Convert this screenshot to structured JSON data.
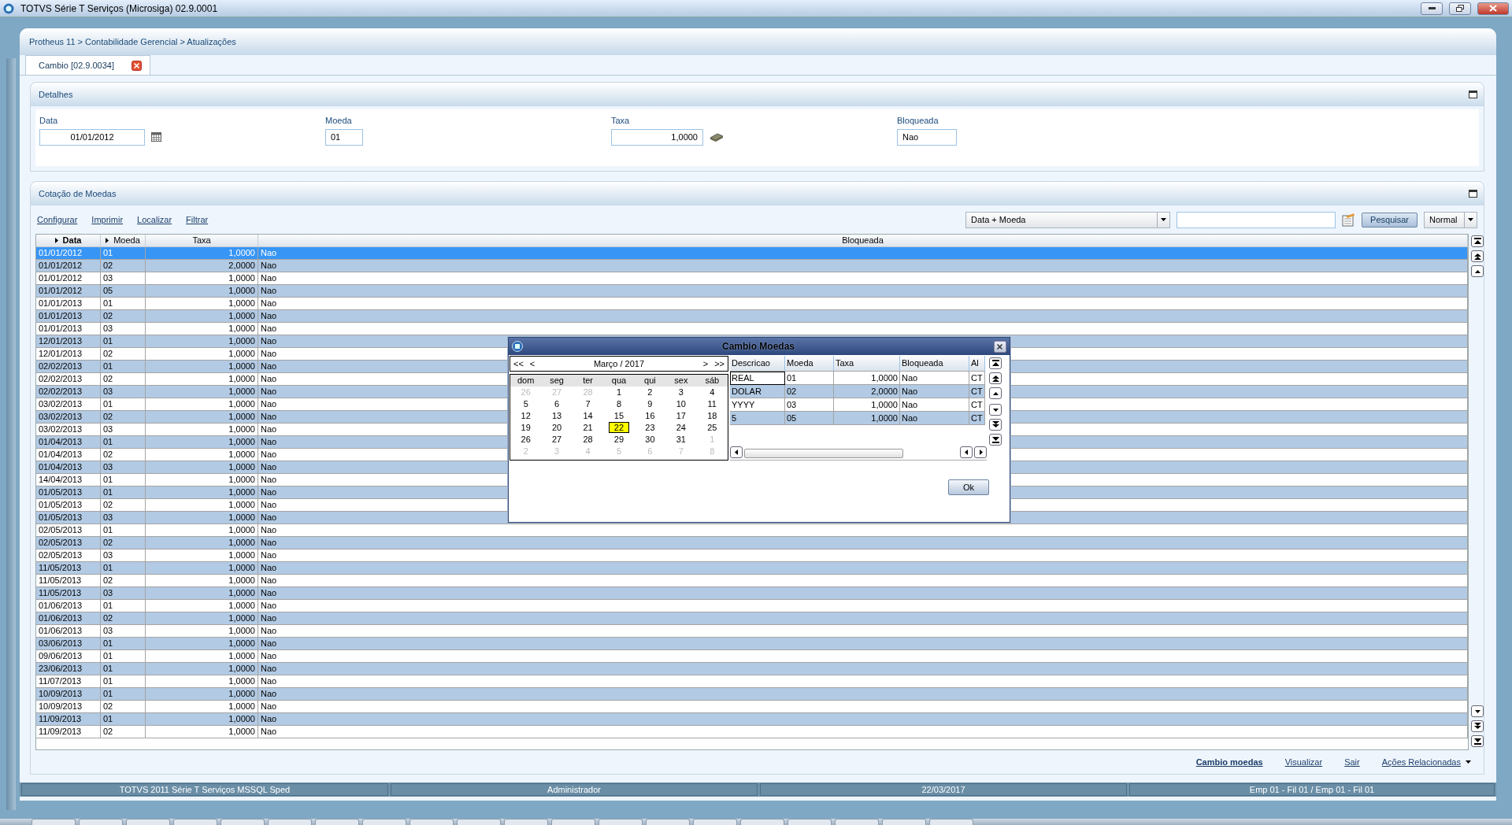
{
  "window": {
    "title": "TOTVS Série T Serviços (Microsiga) 02.9.0001"
  },
  "breadcrumb": "Protheus 11 > Contabilidade Gerencial > Atualizações",
  "tabs": [
    {
      "label": "Cambio [02.9.0034]",
      "selected": true
    }
  ],
  "details": {
    "title": "Detalhes",
    "fields": [
      {
        "label": "Data",
        "value": "01/01/2012",
        "kind": "date"
      },
      {
        "label": "Moeda",
        "value": "01",
        "kind": "text"
      },
      {
        "label": "Taxa",
        "value": "1,0000",
        "kind": "money"
      },
      {
        "label": "Bloqueada",
        "value": "Nao",
        "kind": "text"
      }
    ]
  },
  "quotes": {
    "title": "Cotação de Moedas",
    "links": [
      "Configurar",
      "Imprimir",
      "Localizar",
      "Filtrar"
    ],
    "order_select": "Data + Moeda",
    "search_button": "Pesquisar",
    "mode_select": "Normal",
    "columns": [
      {
        "label": "Data",
        "arrow": true,
        "bold": true
      },
      {
        "label": "Moeda",
        "arrow": true,
        "bold": false
      },
      {
        "label": "Taxa",
        "arrow": false,
        "bold": false
      },
      {
        "label": "Bloqueada",
        "arrow": false,
        "bold": false
      }
    ],
    "rows": [
      {
        "cells": [
          "01/01/2012",
          "01",
          "1,0000",
          "Nao"
        ],
        "selected": true
      },
      {
        "cells": [
          "01/01/2012",
          "02",
          "2,0000",
          "Nao"
        ],
        "selected": false
      },
      {
        "cells": [
          "01/01/2012",
          "03",
          "1,0000",
          "Nao"
        ],
        "selected": false
      },
      {
        "cells": [
          "01/01/2012",
          "05",
          "1,0000",
          "Nao"
        ],
        "selected": false
      },
      {
        "cells": [
          "01/01/2013",
          "01",
          "1,0000",
          "Nao"
        ],
        "selected": false
      },
      {
        "cells": [
          "01/01/2013",
          "02",
          "1,0000",
          "Nao"
        ],
        "selected": false
      },
      {
        "cells": [
          "01/01/2013",
          "03",
          "1,0000",
          "Nao"
        ],
        "selected": false
      },
      {
        "cells": [
          "12/01/2013",
          "01",
          "1,0000",
          "Nao"
        ],
        "selected": false
      },
      {
        "cells": [
          "12/01/2013",
          "02",
          "1,0000",
          "Nao"
        ],
        "selected": false
      },
      {
        "cells": [
          "02/02/2013",
          "01",
          "1,0000",
          "Nao"
        ],
        "selected": false
      },
      {
        "cells": [
          "02/02/2013",
          "02",
          "1,0000",
          "Nao"
        ],
        "selected": false
      },
      {
        "cells": [
          "02/02/2013",
          "03",
          "1,0000",
          "Nao"
        ],
        "selected": false
      },
      {
        "cells": [
          "03/02/2013",
          "01",
          "1,0000",
          "Nao"
        ],
        "selected": false
      },
      {
        "cells": [
          "03/02/2013",
          "02",
          "1,0000",
          "Nao"
        ],
        "selected": false
      },
      {
        "cells": [
          "03/02/2013",
          "03",
          "1,0000",
          "Nao"
        ],
        "selected": false
      },
      {
        "cells": [
          "01/04/2013",
          "01",
          "1,0000",
          "Nao"
        ],
        "selected": false
      },
      {
        "cells": [
          "01/04/2013",
          "02",
          "1,0000",
          "Nao"
        ],
        "selected": false
      },
      {
        "cells": [
          "01/04/2013",
          "03",
          "1,0000",
          "Nao"
        ],
        "selected": false
      },
      {
        "cells": [
          "14/04/2013",
          "01",
          "1,0000",
          "Nao"
        ],
        "selected": false
      },
      {
        "cells": [
          "01/05/2013",
          "01",
          "1,0000",
          "Nao"
        ],
        "selected": false
      },
      {
        "cells": [
          "01/05/2013",
          "02",
          "1,0000",
          "Nao"
        ],
        "selected": false
      },
      {
        "cells": [
          "01/05/2013",
          "03",
          "1,0000",
          "Nao"
        ],
        "selected": false
      },
      {
        "cells": [
          "02/05/2013",
          "01",
          "1,0000",
          "Nao"
        ],
        "selected": false
      },
      {
        "cells": [
          "02/05/2013",
          "02",
          "1,0000",
          "Nao"
        ],
        "selected": false
      },
      {
        "cells": [
          "02/05/2013",
          "03",
          "1,0000",
          "Nao"
        ],
        "selected": false
      },
      {
        "cells": [
          "11/05/2013",
          "01",
          "1,0000",
          "Nao"
        ],
        "selected": false
      },
      {
        "cells": [
          "11/05/2013",
          "02",
          "1,0000",
          "Nao"
        ],
        "selected": false
      },
      {
        "cells": [
          "11/05/2013",
          "03",
          "1,0000",
          "Nao"
        ],
        "selected": false
      },
      {
        "cells": [
          "01/06/2013",
          "01",
          "1,0000",
          "Nao"
        ],
        "selected": false
      },
      {
        "cells": [
          "01/06/2013",
          "02",
          "1,0000",
          "Nao"
        ],
        "selected": false
      },
      {
        "cells": [
          "01/06/2013",
          "03",
          "1,0000",
          "Nao"
        ],
        "selected": false
      },
      {
        "cells": [
          "03/06/2013",
          "01",
          "1,0000",
          "Nao"
        ],
        "selected": false
      },
      {
        "cells": [
          "09/06/2013",
          "01",
          "1,0000",
          "Nao"
        ],
        "selected": false
      },
      {
        "cells": [
          "23/06/2013",
          "01",
          "1,0000",
          "Nao"
        ],
        "selected": false
      },
      {
        "cells": [
          "11/07/2013",
          "01",
          "1,0000",
          "Nao"
        ],
        "selected": false
      },
      {
        "cells": [
          "10/09/2013",
          "01",
          "1,0000",
          "Nao"
        ],
        "selected": false
      },
      {
        "cells": [
          "10/09/2013",
          "02",
          "1,0000",
          "Nao"
        ],
        "selected": false
      },
      {
        "cells": [
          "11/09/2013",
          "01",
          "1,0000",
          "Nao"
        ],
        "selected": false
      },
      {
        "cells": [
          "11/09/2013",
          "02",
          "1,0000",
          "Nao"
        ],
        "selected": false
      }
    ]
  },
  "dialog": {
    "title": "Cambio Moedas",
    "calendar": {
      "prev_year": "<<",
      "prev_month": "<",
      "month": "Março / 2017",
      "next_month": ">",
      "next_year": ">>",
      "weekdays": [
        "dom",
        "seg",
        "ter",
        "qua",
        "qui",
        "sex",
        "sáb"
      ],
      "weeks": [
        [
          {
            "day": "26",
            "other_month": true,
            "selected": false
          },
          {
            "day": "27",
            "other_month": true,
            "selected": false
          },
          {
            "day": "28",
            "other_month": true,
            "selected": false
          },
          {
            "day": "1",
            "other_month": false,
            "selected": false
          },
          {
            "day": "2",
            "other_month": false,
            "selected": false
          },
          {
            "day": "3",
            "other_month": false,
            "selected": false
          },
          {
            "day": "4",
            "other_month": false,
            "selected": false
          }
        ],
        [
          {
            "day": "5",
            "other_month": false,
            "selected": false
          },
          {
            "day": "6",
            "other_month": false,
            "selected": false
          },
          {
            "day": "7",
            "other_month": false,
            "selected": false
          },
          {
            "day": "8",
            "other_month": false,
            "selected": false
          },
          {
            "day": "9",
            "other_month": false,
            "selected": false
          },
          {
            "day": "10",
            "other_month": false,
            "selected": false
          },
          {
            "day": "11",
            "other_month": false,
            "selected": false
          }
        ],
        [
          {
            "day": "12",
            "other_month": false,
            "selected": false
          },
          {
            "day": "13",
            "other_month": false,
            "selected": false
          },
          {
            "day": "14",
            "other_month": false,
            "selected": false
          },
          {
            "day": "15",
            "other_month": false,
            "selected": false
          },
          {
            "day": "16",
            "other_month": false,
            "selected": false
          },
          {
            "day": "17",
            "other_month": false,
            "selected": false
          },
          {
            "day": "18",
            "other_month": false,
            "selected": false
          }
        ],
        [
          {
            "day": "19",
            "other_month": false,
            "selected": false
          },
          {
            "day": "20",
            "other_month": false,
            "selected": false
          },
          {
            "day": "21",
            "other_month": false,
            "selected": false
          },
          {
            "day": "22",
            "other_month": false,
            "selected": true
          },
          {
            "day": "23",
            "other_month": false,
            "selected": false
          },
          {
            "day": "24",
            "other_month": false,
            "selected": false
          },
          {
            "day": "25",
            "other_month": false,
            "selected": false
          }
        ],
        [
          {
            "day": "26",
            "other_month": false,
            "selected": false
          },
          {
            "day": "27",
            "other_month": false,
            "selected": false
          },
          {
            "day": "28",
            "other_month": false,
            "selected": false
          },
          {
            "day": "29",
            "other_month": false,
            "selected": false
          },
          {
            "day": "30",
            "other_month": false,
            "selected": false
          },
          {
            "day": "31",
            "other_month": false,
            "selected": false
          },
          {
            "day": "1",
            "other_month": true,
            "selected": false
          }
        ],
        [
          {
            "day": "2",
            "other_month": true,
            "selected": false
          },
          {
            "day": "3",
            "other_month": true,
            "selected": false
          },
          {
            "day": "4",
            "other_month": true,
            "selected": false
          },
          {
            "day": "5",
            "other_month": true,
            "selected": false
          },
          {
            "day": "6",
            "other_month": true,
            "selected": false
          },
          {
            "day": "7",
            "other_month": true,
            "selected": false
          },
          {
            "day": "8",
            "other_month": true,
            "selected": false
          }
        ]
      ]
    },
    "grid": {
      "columns": [
        "Descricao",
        "Moeda",
        "Taxa",
        "Bloqueada",
        "Al"
      ],
      "rows": [
        {
          "cells": [
            "REAL",
            "01",
            "1,0000",
            "Nao",
            "CT"
          ],
          "selected": true
        },
        {
          "cells": [
            "DOLAR",
            "02",
            "2,0000",
            "Nao",
            "CT"
          ],
          "selected": false
        },
        {
          "cells": [
            "YYYY",
            "03",
            "1,0000",
            "Nao",
            "CT"
          ],
          "selected": false
        },
        {
          "cells": [
            "5",
            "05",
            "1,0000",
            "Nao",
            "CT"
          ],
          "selected": false
        }
      ]
    },
    "ok_button": "Ok"
  },
  "actions": [
    {
      "label": "Cambio moedas",
      "bold": true,
      "menu": false
    },
    {
      "label": "Visualizar",
      "bold": false,
      "menu": false
    },
    {
      "label": "Sair",
      "bold": false,
      "menu": false
    },
    {
      "label": "Ações Relacionadas",
      "bold": false,
      "menu": true
    }
  ],
  "status_bar": [
    "TOTVS 2011 Série T Serviços MSSQL Sped",
    "Administrador",
    "22/03/2017",
    "Emp 01 - Fil 01 / Emp 01 - Fil 01"
  ]
}
